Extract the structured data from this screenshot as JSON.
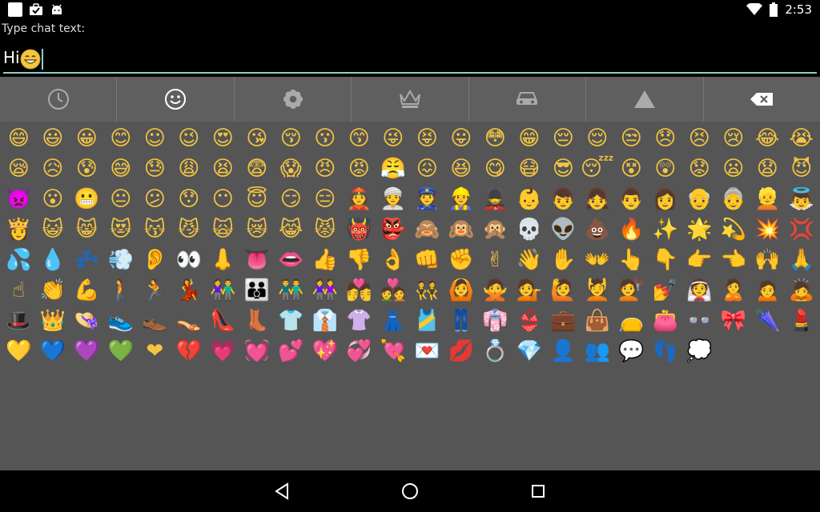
{
  "status_bar": {
    "time": "2:53",
    "left_icons": [
      "blank-square-icon",
      "briefcase-check-icon",
      "android-icon"
    ],
    "right_icons": [
      "wifi-icon",
      "battery-icon"
    ]
  },
  "prompt": {
    "label": "Type chat text:"
  },
  "input": {
    "value": "Hi",
    "value_emoji": "smiling-face-icon"
  },
  "tabs": [
    {
      "name": "recent",
      "icon": "clock-icon"
    },
    {
      "name": "people",
      "icon": "smiley-icon",
      "active": true
    },
    {
      "name": "nature",
      "icon": "flower-icon"
    },
    {
      "name": "objects",
      "icon": "crown-icon"
    },
    {
      "name": "places",
      "icon": "car-icon"
    },
    {
      "name": "symbols",
      "icon": "triangle-icon"
    },
    {
      "name": "backspace",
      "icon": "backspace-icon"
    }
  ],
  "emojis": [
    "😄",
    "😃",
    "😀",
    "😊",
    "☺",
    "😉",
    "😍",
    "😘",
    "😚",
    "😗",
    "😙",
    "😜",
    "😝",
    "😛",
    "😳",
    "😁",
    "😔",
    "😌",
    "😒",
    "😞",
    "😣",
    "😢",
    "😂",
    "😭",
    "😪",
    "😥",
    "😰",
    "😅",
    "😓",
    "😩",
    "😫",
    "😨",
    "😱",
    "😠",
    "😡",
    "😤",
    "😖",
    "😆",
    "😋",
    "😷",
    "😎",
    "😴",
    "😵",
    "😲",
    "😟",
    "😦",
    "😧",
    "😈",
    "👿",
    "😮",
    "😬",
    "😐",
    "😕",
    "😯",
    "😶",
    "😇",
    "😏",
    "😑",
    "👲",
    "👳",
    "👮",
    "👷",
    "💂",
    "👶",
    "👦",
    "👧",
    "👨",
    "👩",
    "👴",
    "👵",
    "👱",
    "👼",
    "👸",
    "😺",
    "😸",
    "😻",
    "😽",
    "😼",
    "🙀",
    "😿",
    "😹",
    "😾",
    "👹",
    "👺",
    "🙈",
    "🙉",
    "🙊",
    "💀",
    "👽",
    "💩",
    "🔥",
    "✨",
    "🌟",
    "💫",
    "💥",
    "💢",
    "💦",
    "💧",
    "💤",
    "💨",
    "👂",
    "👀",
    "👃",
    "👅",
    "👄",
    "👍",
    "👎",
    "👌",
    "👊",
    "✊",
    "✌",
    "👋",
    "✋",
    "👐",
    "👆",
    "👇",
    "👉",
    "👈",
    "🙌",
    "🙏",
    "☝",
    "👏",
    "💪",
    "🚶",
    "🏃",
    "💃",
    "👫",
    "👪",
    "👬",
    "👭",
    "💏",
    "💑",
    "👯",
    "🙆",
    "🙅",
    "💁",
    "🙋",
    "💆",
    "💇",
    "💅",
    "👰",
    "🙎",
    "🙍",
    "🙇",
    "🎩",
    "👑",
    "👒",
    "👟",
    "👞",
    "👡",
    "👠",
    "👢",
    "👕",
    "👔",
    "👚",
    "👗",
    "🎽",
    "👖",
    "👘",
    "👙",
    "💼",
    "👜",
    "👝",
    "👛",
    "👓",
    "🎀",
    "🌂",
    "💄",
    "💛",
    "💙",
    "💜",
    "💚",
    "❤",
    "💔",
    "💗",
    "💓",
    "💕",
    "💖",
    "💞",
    "💘",
    "💌",
    "💋",
    "💍",
    "💎",
    "👤",
    "👥",
    "💬",
    "👣",
    "💭"
  ]
}
